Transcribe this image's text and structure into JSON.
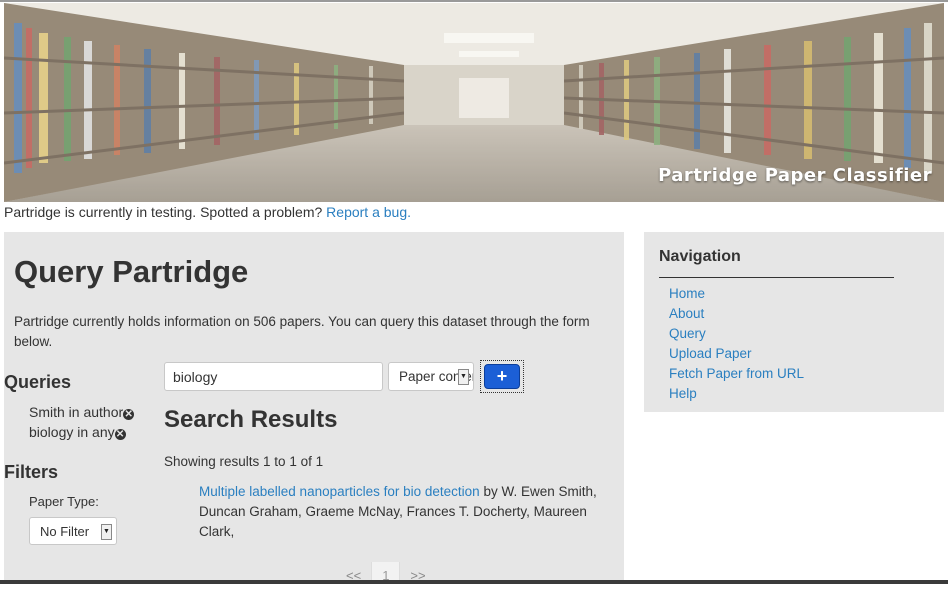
{
  "banner": {
    "title": "Partridge Paper Classifier"
  },
  "notice": {
    "text": "Partridge is currently in testing. Spotted a problem?",
    "link": "Report a bug."
  },
  "main": {
    "title": "Query Partridge",
    "intro": "Partridge currently holds information on 506 papers. You can query this dataset through the form below."
  },
  "queries": {
    "heading": "Queries",
    "items": [
      {
        "label": "Smith in author"
      },
      {
        "label": "biology in any"
      }
    ]
  },
  "filters": {
    "heading": "Filters",
    "paper_type_label": "Paper Type:",
    "paper_type_value": "No Filter"
  },
  "search": {
    "value": "biology",
    "field_value": "Paper content",
    "add_symbol": "+"
  },
  "results": {
    "heading": "Search Results",
    "count_text": "Showing results 1 to 1 of 1",
    "items": [
      {
        "title": "Multiple labelled nanoparticles for bio detection",
        "byline": " by W. Ewen Smith, Duncan Graham, Graeme McNay, Frances T. Docherty, Maureen Clark,"
      }
    ]
  },
  "pager": {
    "prev": "<<",
    "current": "1",
    "next": ">>"
  },
  "navigation": {
    "heading": "Navigation",
    "links": [
      {
        "label": "Home"
      },
      {
        "label": "About"
      },
      {
        "label": "Query"
      },
      {
        "label": "Upload Paper"
      },
      {
        "label": "Fetch Paper from URL"
      },
      {
        "label": "Help"
      }
    ]
  },
  "colors": {
    "link": "#2a7fc0",
    "panel": "#e6e6e6",
    "add_button": "#1c5fd6"
  },
  "icons": {
    "remove_query": "remove-circle-icon",
    "add_query": "plus-icon"
  }
}
